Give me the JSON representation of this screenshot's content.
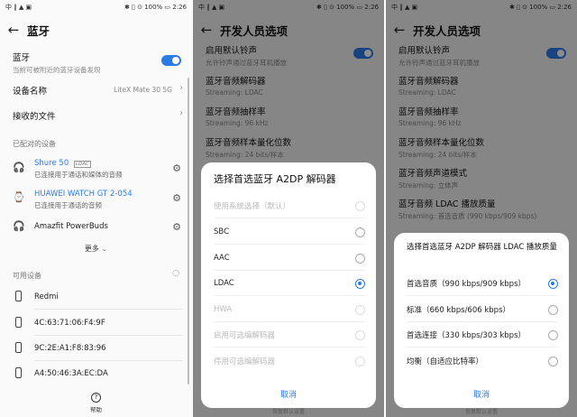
{
  "colors": {
    "accent": "#2c7be5",
    "link": "#2c7be5"
  },
  "status": {
    "left": "中 ‖ ▲ ▣",
    "right": "✱ ▯ ⊙ 100% ▭ 2:26"
  },
  "p1": {
    "title": "蓝牙",
    "bluetooth": {
      "label": "蓝牙",
      "sub": "当前可被附近的蓝牙设备发现",
      "on": true
    },
    "device_name": {
      "label": "设备名称",
      "value": "LiteX Mate 30 5G"
    },
    "received": {
      "label": "接收的文件"
    },
    "paired_header": "已配对的设备",
    "paired": [
      {
        "name": "Shure 50",
        "badge": "LDAC",
        "sub": "已连接用于通话和媒体的音频",
        "icon": "headphones-icon",
        "active": true
      },
      {
        "name": "HUAWEI WATCH GT 2-054",
        "sub": "已连接用于通话的音频",
        "icon": "watch-icon",
        "active": true
      },
      {
        "name": "Amazfit PowerBuds",
        "sub": "",
        "icon": "headphones-icon",
        "active": false
      }
    ],
    "more": "更多",
    "available_header": "可用设备",
    "available": [
      "Redmi",
      "4C:63:71:06:F4:9F",
      "9C:2E:A1:F8:83:96",
      "A4:50:46:3A:EC:DA"
    ],
    "help": "帮助"
  },
  "p2": {
    "title": "开发人员选项",
    "items": [
      {
        "label": "启用默认铃声",
        "sub": "允许铃声通过蓝牙耳机播放",
        "toggle": true
      },
      {
        "label": "蓝牙音频解码器",
        "sub": "Streaming: LDAC"
      },
      {
        "label": "蓝牙音频抽样率",
        "sub": "Streaming: 96 kHz"
      },
      {
        "label": "蓝牙音频样本量化位数",
        "sub": "Streaming: 24 bits/样本"
      }
    ],
    "dialog": {
      "title": "选择首选蓝牙 A2DP 解码器",
      "options": [
        {
          "label": "使用系统选择（默认）",
          "enabled": false,
          "selected": false
        },
        {
          "label": "SBC",
          "enabled": true,
          "selected": false
        },
        {
          "label": "AAC",
          "enabled": true,
          "selected": false
        },
        {
          "label": "LDAC",
          "enabled": true,
          "selected": true
        },
        {
          "label": "HWA",
          "enabled": false,
          "selected": false
        },
        {
          "label": "启用可选编解码器",
          "enabled": false,
          "selected": false
        },
        {
          "label": "停用可选编解码器",
          "enabled": false,
          "selected": false
        }
      ],
      "cancel": "取消"
    },
    "bottom": "恢复默认设置"
  },
  "p3": {
    "title": "开发人员选项",
    "items": [
      {
        "label": "启用默认铃声",
        "sub": "允许铃声通过蓝牙耳机播放",
        "toggle": true
      },
      {
        "label": "蓝牙音频解码器",
        "sub": "Streaming: LDAC"
      },
      {
        "label": "蓝牙音频抽样率",
        "sub": "Streaming: 96 kHz"
      },
      {
        "label": "蓝牙音频样本量化位数",
        "sub": "Streaming: 24 bits/样本"
      },
      {
        "label": "蓝牙音频声道模式",
        "sub": "Streaming: 立体声"
      },
      {
        "label": "蓝牙音频 LDAC 播放质量",
        "sub": "Streaming: 首选音质 (990 kbps/909 kbps)"
      }
    ],
    "dialog": {
      "title": "选择首选蓝牙 A2DP 解码器 LDAC 播放质量",
      "options": [
        {
          "label": "首选音质（990 kbps/909 kbps）",
          "selected": true
        },
        {
          "label": "标准（660 kbps/606 kbps）",
          "selected": false
        },
        {
          "label": "首选连接（330 kbps/303 kbps）",
          "selected": false
        },
        {
          "label": "均衡（自适应比特率）",
          "selected": false
        }
      ],
      "cancel": "取消"
    },
    "bottom": "恢复默认设置"
  }
}
